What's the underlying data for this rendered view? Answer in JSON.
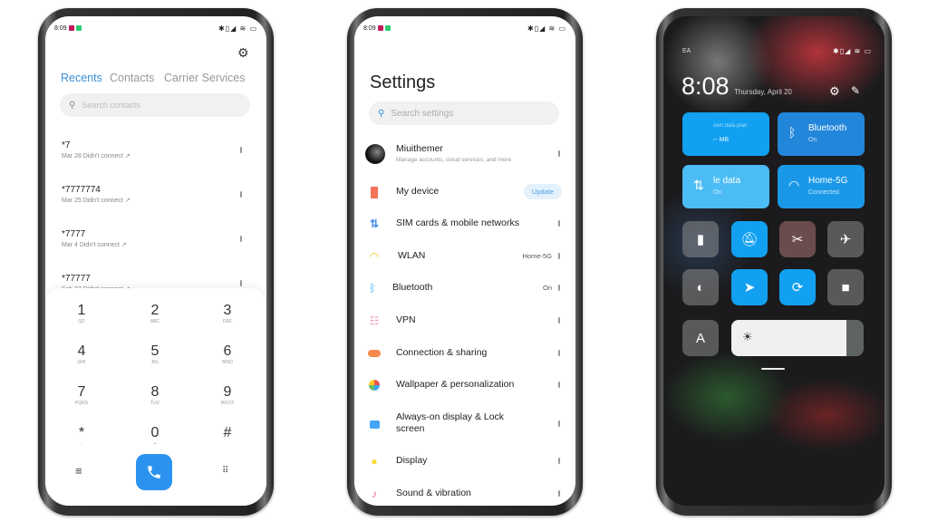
{
  "status": {
    "time": "8:09",
    "icons": "✱▯◢ ≋ ▭"
  },
  "dialer": {
    "tabs": [
      "Recents",
      "Contacts",
      "Carrier Services"
    ],
    "search_placeholder": "Search contacts",
    "calls": [
      {
        "number": "*7",
        "detail": "Mar 28 Didn't connect ↗"
      },
      {
        "number": "*7777774",
        "detail": "Mar 25 Didn't connect ↗"
      },
      {
        "number": "*7777",
        "detail": "Mar 4 Didn't connect ↗"
      },
      {
        "number": "*77777",
        "detail": "Feb 27 Didn't connect ↗"
      }
    ],
    "keys": [
      {
        "d": "1",
        "l": "QD"
      },
      {
        "d": "2",
        "l": "ABC"
      },
      {
        "d": "3",
        "l": "DEF"
      },
      {
        "d": "4",
        "l": "GHI"
      },
      {
        "d": "5",
        "l": "JKL"
      },
      {
        "d": "6",
        "l": "MNO"
      },
      {
        "d": "7",
        "l": "PQRS"
      },
      {
        "d": "8",
        "l": "TUV"
      },
      {
        "d": "9",
        "l": "WXYZ"
      },
      {
        "d": "*",
        "l": ","
      },
      {
        "d": "0",
        "l": "+"
      },
      {
        "d": "#",
        "l": ""
      }
    ],
    "accent": "#2b93ef"
  },
  "settings": {
    "title": "Settings",
    "search_placeholder": "Search settings",
    "account": {
      "name": "Miuithemer",
      "sub": "Manage accounts, cloud services, and more"
    },
    "items": [
      {
        "label": "My device",
        "value": "Update",
        "icon": "phone-icon",
        "color": "#f0735a"
      },
      {
        "label": "SIM cards & mobile networks",
        "value": "",
        "icon": "sim-icon",
        "color": "#4a8fe8"
      },
      {
        "label": "WLAN",
        "value": "Home-5G",
        "icon": "wifi-icon",
        "color": "#f5c518"
      },
      {
        "label": "Bluetooth",
        "value": "On",
        "icon": "bluetooth-icon",
        "color": "#29b6f6"
      },
      {
        "label": "VPN",
        "value": "",
        "icon": "vpn-icon",
        "color": "#f48fb1"
      },
      {
        "label": "Connection & sharing",
        "value": "",
        "icon": "connection-icon",
        "color": "#f58a4c"
      },
      {
        "label": "Wallpaper & personalization",
        "value": "",
        "icon": "wallpaper-icon",
        "color": "#66bb6a"
      },
      {
        "label": "Always-on display & Lock screen",
        "value": "",
        "icon": "lock-screen-icon",
        "color": "#42a5f5"
      },
      {
        "label": "Display",
        "value": "",
        "icon": "display-icon",
        "color": "#fdd835"
      },
      {
        "label": "Sound & vibration",
        "value": "",
        "icon": "sound-icon",
        "color": "#f06292"
      }
    ]
  },
  "control": {
    "carrier": "EA",
    "time": "8:08",
    "date": "Thursday, April 20",
    "tiles": [
      {
        "title": "own data plan",
        "sub": "-- MB"
      },
      {
        "title": "Bluetooth",
        "sub": "On"
      },
      {
        "title": "le data",
        "sub": "On"
      },
      {
        "title": "Home-5G",
        "sub": "Connected"
      }
    ],
    "font_button": "A",
    "brightness_percent": 87,
    "accent": "#12a0f0"
  }
}
